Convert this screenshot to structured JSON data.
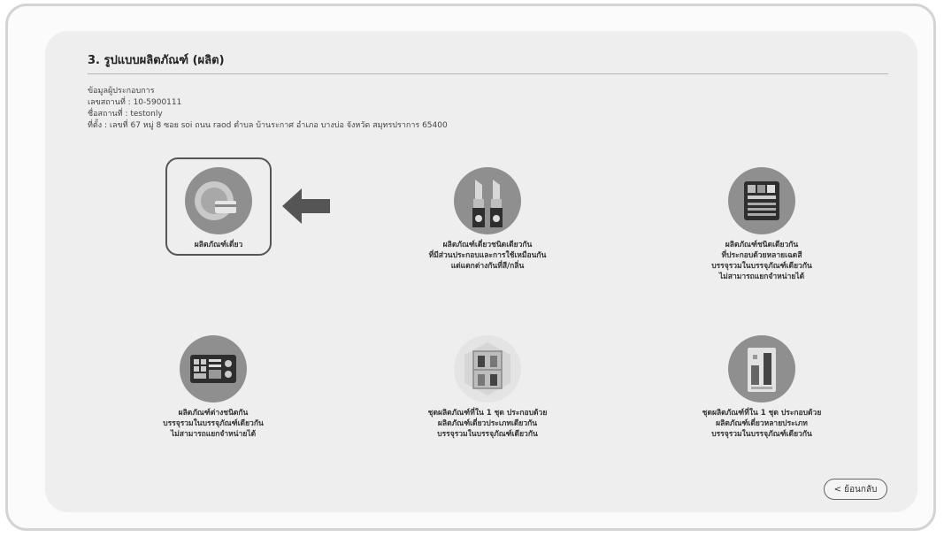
{
  "section": {
    "title": "3. รูปแบบผลิตภัณฑ์ (ผลิต)"
  },
  "operator": {
    "heading": "ข้อมูลผู้ประกอบการ",
    "license_line": "เลขสถานที่ : 10-5900111",
    "name_line": "ชื่อสถานที่ : testonly",
    "address_line": "ที่ตั้ง : เลขที่ 67 หมู่ 8 ซอย soi ถนน raod ตำบล บ้านระกาศ อำเภอ บางบ่อ จังหวัด สมุทรปราการ 65400"
  },
  "options": [
    {
      "id": "single",
      "icon": "food-plate-icon",
      "lines": [
        "ผลิตภัณฑ์เดี่ยว"
      ]
    },
    {
      "id": "same-type-diff-flavor",
      "icon": "lipstick-icon",
      "lines": [
        "ผลิตภัณฑ์เดี่ยวชนิดเดียวกัน",
        "ที่มีส่วนประกอบและการใช้เหมือนกัน",
        "แต่แตกต่างกันที่สี/กลิ่น"
      ]
    },
    {
      "id": "same-type-multi-color",
      "icon": "palette-icon",
      "lines": [
        "ผลิตภัณฑ์ชนิดเดียวกัน",
        "ที่ประกอบด้วยหลายเฉดสี",
        "บรรจุรวมในบรรจุภัณฑ์เดียวกัน",
        "ไม่สามารถแยกจำหน่ายได้"
      ]
    },
    {
      "id": "diff-type-one-pack",
      "icon": "makeup-kit-icon",
      "lines": [
        "ผลิตภัณฑ์ต่างชนิดกัน",
        "บรรจุรวมในบรรจุภัณฑ์เดียวกัน",
        "ไม่สามารถแยกจำหน่ายได้"
      ]
    },
    {
      "id": "set-same-category",
      "icon": "bottle-set-icon",
      "lines": [
        "ชุดผลิตภัณฑ์ที่ใน 1 ชุด ประกอบด้วย",
        "ผลิตภัณฑ์เดี่ยวประเภทเดียวกัน",
        "บรรจุรวมในบรรจุภัณฑ์เดียวกัน"
      ]
    },
    {
      "id": "set-multi-category",
      "icon": "product-set-icon",
      "lines": [
        "ชุดผลิตภัณฑ์ที่ใน 1 ชุด ประกอบด้วย",
        "ผลิตภัณฑ์เดี่ยวหลายประเภท",
        "บรรจุรวมในบรรจุภัณฑ์เดียวกัน"
      ]
    }
  ],
  "back_button": {
    "label": "< ย้อนกลับ"
  },
  "colors": {
    "icon_bg": "#8f8f8f",
    "panel_bg": "#eeeeee",
    "selected_border": "#555555"
  }
}
